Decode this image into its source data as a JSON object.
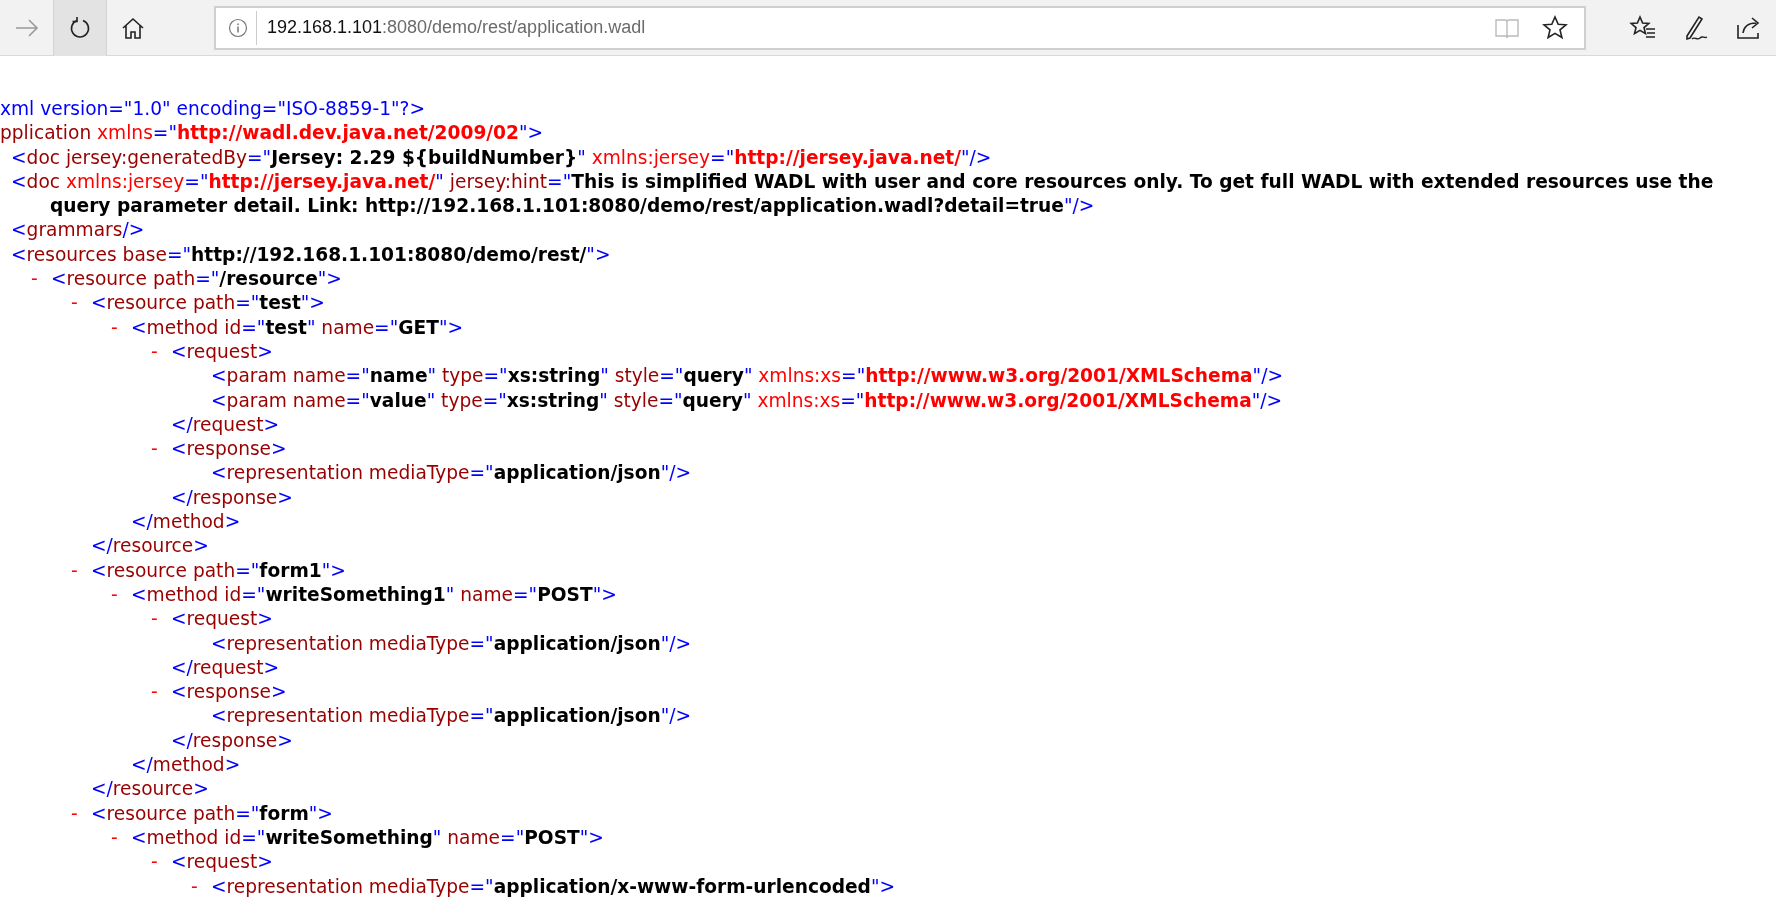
{
  "address_bar": {
    "host": "192.168.1.101",
    "rest": ":8080/demo/rest/application.wadl"
  },
  "xml_lines": [
    {
      "line": [
        {
          "kind": "markup",
          "text": "xml version=\"1.0\" encoding=\"ISO-8859-1\"?>"
        }
      ]
    },
    {
      "line": [
        {
          "kind": "name",
          "text": "pplication"
        },
        {
          "kind": "ns",
          "text": " xmlns"
        },
        {
          "kind": "markup",
          "text": "=\""
        },
        {
          "kind": "nsvalue",
          "text": "http://wadl.dev.java.net/2009/02"
        },
        {
          "kind": "markup",
          "text": "\">"
        }
      ],
      "children": [
        {
          "line": [
            {
              "kind": "markup",
              "text": "<"
            },
            {
              "kind": "name",
              "text": "doc jersey:generatedBy"
            },
            {
              "kind": "markup",
              "text": "=\""
            },
            {
              "kind": "value",
              "text": "Jersey: 2.29 ${buildNumber}"
            },
            {
              "kind": "markup",
              "text": "\""
            },
            {
              "kind": "ns",
              "text": " xmlns:jersey"
            },
            {
              "kind": "markup",
              "text": "=\""
            },
            {
              "kind": "nsvalue",
              "text": "http://jersey.java.net/"
            },
            {
              "kind": "markup",
              "text": "\"/>"
            }
          ]
        },
        {
          "line": [
            {
              "kind": "markup",
              "text": "<"
            },
            {
              "kind": "name",
              "text": "doc"
            },
            {
              "kind": "ns",
              "text": " xmlns:jersey"
            },
            {
              "kind": "markup",
              "text": "=\""
            },
            {
              "kind": "nsvalue",
              "text": "http://jersey.java.net/"
            },
            {
              "kind": "markup",
              "text": "\""
            },
            {
              "kind": "name",
              "text": " jersey:hint"
            },
            {
              "kind": "markup",
              "text": "=\""
            },
            {
              "kind": "value",
              "text": "This is simplified WADL with user and core resources only. To get full WADL with extended resources use the query parameter detail. Link: http://192.168.1.101:8080/demo/rest/application.wadl?detail=true"
            },
            {
              "kind": "markup",
              "text": "\"/>"
            }
          ]
        },
        {
          "line": [
            {
              "kind": "markup",
              "text": "<"
            },
            {
              "kind": "name",
              "text": "grammars"
            },
            {
              "kind": "markup",
              "text": "/>"
            }
          ]
        },
        {
          "line": [
            {
              "kind": "markup",
              "text": "<"
            },
            {
              "kind": "name",
              "text": "resources base"
            },
            {
              "kind": "markup",
              "text": "=\""
            },
            {
              "kind": "value",
              "text": "http://192.168.1.101:8080/demo/rest/"
            },
            {
              "kind": "markup",
              "text": "\">"
            }
          ],
          "children": [
            {
              "toggle": "-",
              "line": [
                {
                  "kind": "markup",
                  "text": "<"
                },
                {
                  "kind": "name",
                  "text": "resource path"
                },
                {
                  "kind": "markup",
                  "text": "=\""
                },
                {
                  "kind": "value",
                  "text": "/resource"
                },
                {
                  "kind": "markup",
                  "text": "\">"
                }
              ],
              "children": [
                {
                  "toggle": "-",
                  "line": [
                    {
                      "kind": "markup",
                      "text": "<"
                    },
                    {
                      "kind": "name",
                      "text": "resource path"
                    },
                    {
                      "kind": "markup",
                      "text": "=\""
                    },
                    {
                      "kind": "value",
                      "text": "test"
                    },
                    {
                      "kind": "markup",
                      "text": "\">"
                    }
                  ],
                  "children": [
                    {
                      "toggle": "-",
                      "line": [
                        {
                          "kind": "markup",
                          "text": "<"
                        },
                        {
                          "kind": "name",
                          "text": "method id"
                        },
                        {
                          "kind": "markup",
                          "text": "=\""
                        },
                        {
                          "kind": "value",
                          "text": "test"
                        },
                        {
                          "kind": "markup",
                          "text": "\""
                        },
                        {
                          "kind": "name",
                          "text": " name"
                        },
                        {
                          "kind": "markup",
                          "text": "=\""
                        },
                        {
                          "kind": "value",
                          "text": "GET"
                        },
                        {
                          "kind": "markup",
                          "text": "\">"
                        }
                      ],
                      "children": [
                        {
                          "toggle": "-",
                          "line": [
                            {
                              "kind": "markup",
                              "text": "<"
                            },
                            {
                              "kind": "name",
                              "text": "request"
                            },
                            {
                              "kind": "markup",
                              "text": ">"
                            }
                          ],
                          "children": [
                            {
                              "line": [
                                {
                                  "kind": "markup",
                                  "text": "<"
                                },
                                {
                                  "kind": "name",
                                  "text": "param name"
                                },
                                {
                                  "kind": "markup",
                                  "text": "=\""
                                },
                                {
                                  "kind": "value",
                                  "text": "name"
                                },
                                {
                                  "kind": "markup",
                                  "text": "\""
                                },
                                {
                                  "kind": "name",
                                  "text": " type"
                                },
                                {
                                  "kind": "markup",
                                  "text": "=\""
                                },
                                {
                                  "kind": "value",
                                  "text": "xs:string"
                                },
                                {
                                  "kind": "markup",
                                  "text": "\""
                                },
                                {
                                  "kind": "name",
                                  "text": " style"
                                },
                                {
                                  "kind": "markup",
                                  "text": "=\""
                                },
                                {
                                  "kind": "value",
                                  "text": "query"
                                },
                                {
                                  "kind": "markup",
                                  "text": "\""
                                },
                                {
                                  "kind": "ns",
                                  "text": " xmlns:xs"
                                },
                                {
                                  "kind": "markup",
                                  "text": "=\""
                                },
                                {
                                  "kind": "nsvalue",
                                  "text": "http://www.w3.org/2001/XMLSchema"
                                },
                                {
                                  "kind": "markup",
                                  "text": "\"/>"
                                }
                              ]
                            },
                            {
                              "line": [
                                {
                                  "kind": "markup",
                                  "text": "<"
                                },
                                {
                                  "kind": "name",
                                  "text": "param name"
                                },
                                {
                                  "kind": "markup",
                                  "text": "=\""
                                },
                                {
                                  "kind": "value",
                                  "text": "value"
                                },
                                {
                                  "kind": "markup",
                                  "text": "\""
                                },
                                {
                                  "kind": "name",
                                  "text": " type"
                                },
                                {
                                  "kind": "markup",
                                  "text": "=\""
                                },
                                {
                                  "kind": "value",
                                  "text": "xs:string"
                                },
                                {
                                  "kind": "markup",
                                  "text": "\""
                                },
                                {
                                  "kind": "name",
                                  "text": " style"
                                },
                                {
                                  "kind": "markup",
                                  "text": "=\""
                                },
                                {
                                  "kind": "value",
                                  "text": "query"
                                },
                                {
                                  "kind": "markup",
                                  "text": "\""
                                },
                                {
                                  "kind": "ns",
                                  "text": " xmlns:xs"
                                },
                                {
                                  "kind": "markup",
                                  "text": "=\""
                                },
                                {
                                  "kind": "nsvalue",
                                  "text": "http://www.w3.org/2001/XMLSchema"
                                },
                                {
                                  "kind": "markup",
                                  "text": "\"/>"
                                }
                              ]
                            }
                          ],
                          "close": [
                            {
                              "kind": "markup",
                              "text": "</"
                            },
                            {
                              "kind": "name",
                              "text": "request"
                            },
                            {
                              "kind": "markup",
                              "text": ">"
                            }
                          ]
                        },
                        {
                          "toggle": "-",
                          "line": [
                            {
                              "kind": "markup",
                              "text": "<"
                            },
                            {
                              "kind": "name",
                              "text": "response"
                            },
                            {
                              "kind": "markup",
                              "text": ">"
                            }
                          ],
                          "children": [
                            {
                              "line": [
                                {
                                  "kind": "markup",
                                  "text": "<"
                                },
                                {
                                  "kind": "name",
                                  "text": "representation mediaType"
                                },
                                {
                                  "kind": "markup",
                                  "text": "=\""
                                },
                                {
                                  "kind": "value",
                                  "text": "application/json"
                                },
                                {
                                  "kind": "markup",
                                  "text": "\"/>"
                                }
                              ]
                            }
                          ],
                          "close": [
                            {
                              "kind": "markup",
                              "text": "</"
                            },
                            {
                              "kind": "name",
                              "text": "response"
                            },
                            {
                              "kind": "markup",
                              "text": ">"
                            }
                          ]
                        }
                      ],
                      "close": [
                        {
                          "kind": "markup",
                          "text": "</"
                        },
                        {
                          "kind": "name",
                          "text": "method"
                        },
                        {
                          "kind": "markup",
                          "text": ">"
                        }
                      ]
                    }
                  ],
                  "close": [
                    {
                      "kind": "markup",
                      "text": "</"
                    },
                    {
                      "kind": "name",
                      "text": "resource"
                    },
                    {
                      "kind": "markup",
                      "text": ">"
                    }
                  ]
                },
                {
                  "toggle": "-",
                  "line": [
                    {
                      "kind": "markup",
                      "text": "<"
                    },
                    {
                      "kind": "name",
                      "text": "resource path"
                    },
                    {
                      "kind": "markup",
                      "text": "=\""
                    },
                    {
                      "kind": "value",
                      "text": "form1"
                    },
                    {
                      "kind": "markup",
                      "text": "\">"
                    }
                  ],
                  "children": [
                    {
                      "toggle": "-",
                      "line": [
                        {
                          "kind": "markup",
                          "text": "<"
                        },
                        {
                          "kind": "name",
                          "text": "method id"
                        },
                        {
                          "kind": "markup",
                          "text": "=\""
                        },
                        {
                          "kind": "value",
                          "text": "writeSomething1"
                        },
                        {
                          "kind": "markup",
                          "text": "\""
                        },
                        {
                          "kind": "name",
                          "text": " name"
                        },
                        {
                          "kind": "markup",
                          "text": "=\""
                        },
                        {
                          "kind": "value",
                          "text": "POST"
                        },
                        {
                          "kind": "markup",
                          "text": "\">"
                        }
                      ],
                      "children": [
                        {
                          "toggle": "-",
                          "line": [
                            {
                              "kind": "markup",
                              "text": "<"
                            },
                            {
                              "kind": "name",
                              "text": "request"
                            },
                            {
                              "kind": "markup",
                              "text": ">"
                            }
                          ],
                          "children": [
                            {
                              "line": [
                                {
                                  "kind": "markup",
                                  "text": "<"
                                },
                                {
                                  "kind": "name",
                                  "text": "representation mediaType"
                                },
                                {
                                  "kind": "markup",
                                  "text": "=\""
                                },
                                {
                                  "kind": "value",
                                  "text": "application/json"
                                },
                                {
                                  "kind": "markup",
                                  "text": "\"/>"
                                }
                              ]
                            }
                          ],
                          "close": [
                            {
                              "kind": "markup",
                              "text": "</"
                            },
                            {
                              "kind": "name",
                              "text": "request"
                            },
                            {
                              "kind": "markup",
                              "text": ">"
                            }
                          ]
                        },
                        {
                          "toggle": "-",
                          "line": [
                            {
                              "kind": "markup",
                              "text": "<"
                            },
                            {
                              "kind": "name",
                              "text": "response"
                            },
                            {
                              "kind": "markup",
                              "text": ">"
                            }
                          ],
                          "children": [
                            {
                              "line": [
                                {
                                  "kind": "markup",
                                  "text": "<"
                                },
                                {
                                  "kind": "name",
                                  "text": "representation mediaType"
                                },
                                {
                                  "kind": "markup",
                                  "text": "=\""
                                },
                                {
                                  "kind": "value",
                                  "text": "application/json"
                                },
                                {
                                  "kind": "markup",
                                  "text": "\"/>"
                                }
                              ]
                            }
                          ],
                          "close": [
                            {
                              "kind": "markup",
                              "text": "</"
                            },
                            {
                              "kind": "name",
                              "text": "response"
                            },
                            {
                              "kind": "markup",
                              "text": ">"
                            }
                          ]
                        }
                      ],
                      "close": [
                        {
                          "kind": "markup",
                          "text": "</"
                        },
                        {
                          "kind": "name",
                          "text": "method"
                        },
                        {
                          "kind": "markup",
                          "text": ">"
                        }
                      ]
                    }
                  ],
                  "close": [
                    {
                      "kind": "markup",
                      "text": "</"
                    },
                    {
                      "kind": "name",
                      "text": "resource"
                    },
                    {
                      "kind": "markup",
                      "text": ">"
                    }
                  ]
                },
                {
                  "toggle": "-",
                  "line": [
                    {
                      "kind": "markup",
                      "text": "<"
                    },
                    {
                      "kind": "name",
                      "text": "resource path"
                    },
                    {
                      "kind": "markup",
                      "text": "=\""
                    },
                    {
                      "kind": "value",
                      "text": "form"
                    },
                    {
                      "kind": "markup",
                      "text": "\">"
                    }
                  ],
                  "children": [
                    {
                      "toggle": "-",
                      "line": [
                        {
                          "kind": "markup",
                          "text": "<"
                        },
                        {
                          "kind": "name",
                          "text": "method id"
                        },
                        {
                          "kind": "markup",
                          "text": "=\""
                        },
                        {
                          "kind": "value",
                          "text": "writeSomething"
                        },
                        {
                          "kind": "markup",
                          "text": "\""
                        },
                        {
                          "kind": "name",
                          "text": " name"
                        },
                        {
                          "kind": "markup",
                          "text": "=\""
                        },
                        {
                          "kind": "value",
                          "text": "POST"
                        },
                        {
                          "kind": "markup",
                          "text": "\">"
                        }
                      ],
                      "children": [
                        {
                          "toggle": "-",
                          "line": [
                            {
                              "kind": "markup",
                              "text": "<"
                            },
                            {
                              "kind": "name",
                              "text": "request"
                            },
                            {
                              "kind": "markup",
                              "text": ">"
                            }
                          ],
                          "children": [
                            {
                              "toggle": "-",
                              "line": [
                                {
                                  "kind": "markup",
                                  "text": "<"
                                },
                                {
                                  "kind": "name",
                                  "text": "representation mediaType"
                                },
                                {
                                  "kind": "markup",
                                  "text": "=\""
                                },
                                {
                                  "kind": "value",
                                  "text": "application/x-www-form-urlencoded"
                                },
                                {
                                  "kind": "markup",
                                  "text": "\">"
                                }
                              ]
                            }
                          ]
                        }
                      ]
                    }
                  ]
                }
              ]
            }
          ]
        }
      ]
    }
  ]
}
